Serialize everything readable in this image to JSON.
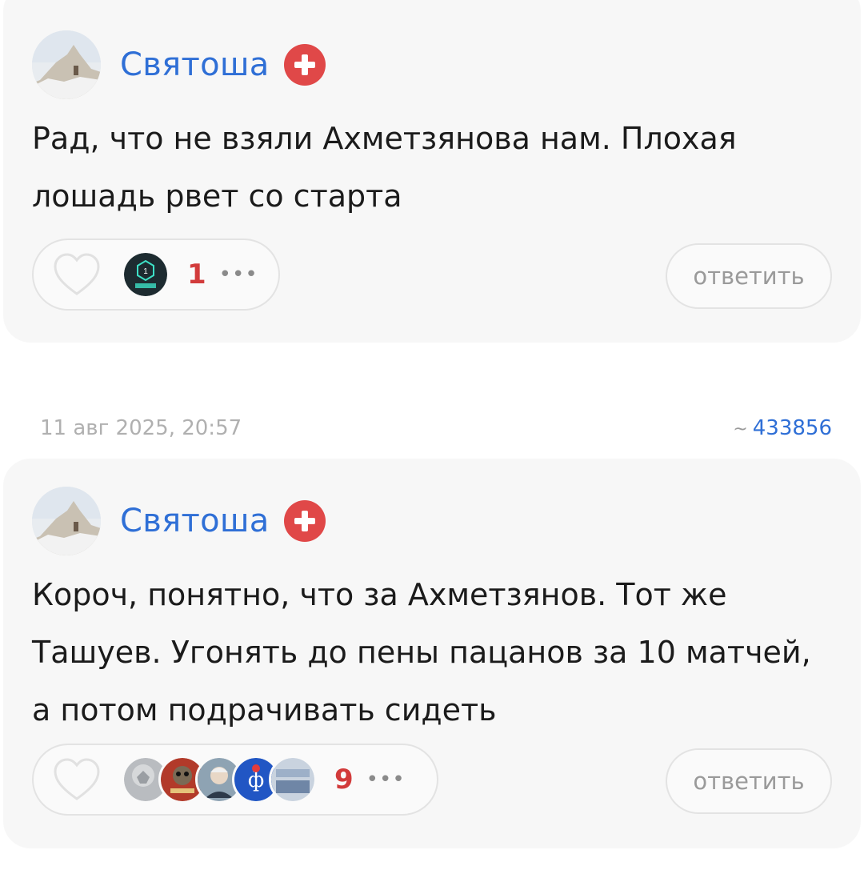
{
  "comments": [
    {
      "username": "Святоша",
      "text": "Рад, что не взяли Ахметзянова нам. Плохая лошадь рвет со старта",
      "reactions": {
        "count": "1",
        "more": "•••"
      },
      "reply_label": "ответить"
    },
    {
      "timestamp": "11 авг 2025, 20:57",
      "id_prefix": "~",
      "id": "433856",
      "username": "Святоша",
      "text": "Короч, понятно, что за Ахметзянов. Тот же Ташуев. Угонять до пены пацанов за 10 матчей, а потом подрачивать сидеть",
      "reactions": {
        "count": "9",
        "more": "•••"
      },
      "reply_label": "ответить"
    }
  ],
  "colors": {
    "username": "#2f6fd6",
    "badge": "#e04848",
    "reaction_count": "#d23b3b",
    "card_bg": "#f7f7f7"
  },
  "icons": [
    "plus-badge-icon",
    "heart-icon",
    "liga-pari-icon",
    "more-dots-icon"
  ]
}
